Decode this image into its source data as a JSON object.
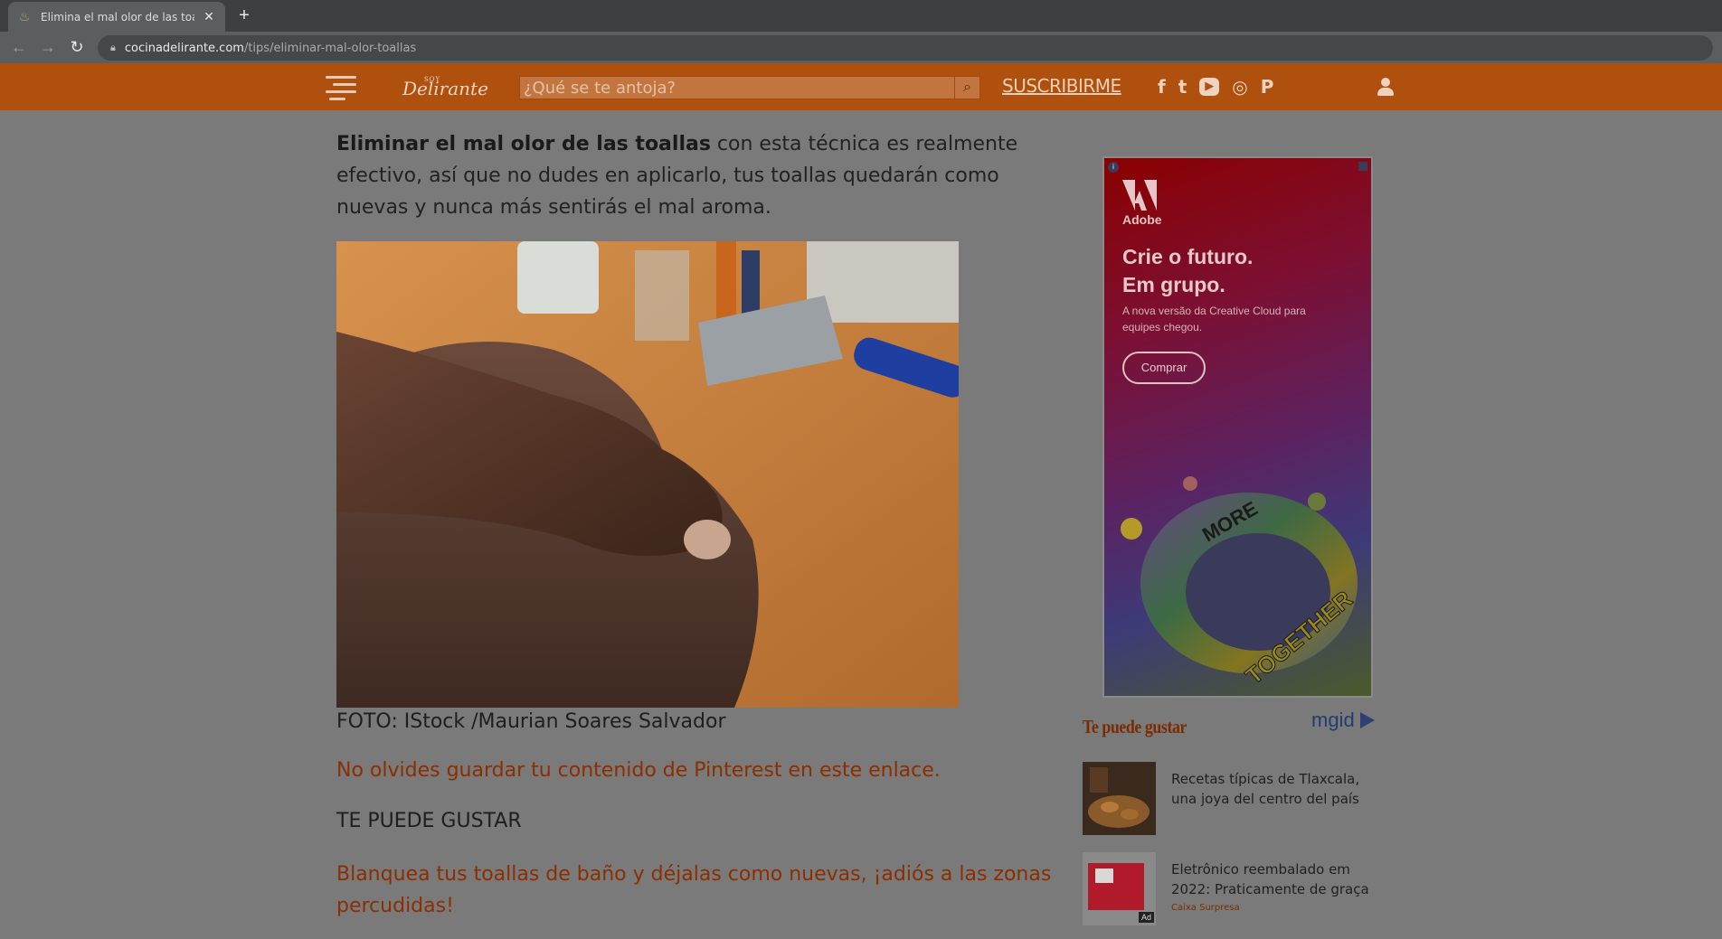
{
  "browser": {
    "tab_title": "Elimina el mal olor de las toallas",
    "url_domain": "cocinadelirante.com",
    "url_path": "/tips/eliminar-mal-olor-toallas"
  },
  "header": {
    "logo_small": "SOY",
    "logo_text": "Delirante",
    "search_placeholder": "¿Qué se te antoja?",
    "subscribe_label": "SUSCRIBIRME",
    "social": {
      "facebook": "f",
      "twitter": "t",
      "youtube": "▶",
      "instagram": "◎",
      "pinterest": "P"
    }
  },
  "article": {
    "intro_bold": "Eliminar el mal olor de las toallas",
    "intro_rest": " con esta técnica es realmente efectivo, así que no dudes en aplicarlo, tus toallas quedarán como nuevas y nunca más sentirás el mal aroma.",
    "photo_caption": "FOTO: IStock /Maurian Soares Salvador",
    "pinterest_link": "No olvides guardar tu contenido de Pinterest en este enlace.",
    "also_like_heading": "TE PUEDE GUSTAR",
    "related_link": "Blanquea tus toallas de baño y déjalas como nuevas, ¡adiós a las zonas percudidas!"
  },
  "ad": {
    "brand": "Adobe",
    "headline_1": "Crie o futuro.",
    "headline_2": "Em grupo.",
    "subtext": "A nova versão da Creative Cloud para equipes chegou.",
    "cta": "Comprar",
    "art_text_1": "MORE",
    "art_text_2": "TOGETHER"
  },
  "recommendations": {
    "title": "Te puede gustar",
    "provider": "mgid",
    "items": [
      {
        "text": "Recetas típicas de Tlaxcala, una joya del centro del país"
      },
      {
        "text": "Eletrônico reembalado em 2022: Praticamente de graça",
        "source": "Caixa Surpresa",
        "ad_tag": "Ad"
      }
    ]
  }
}
